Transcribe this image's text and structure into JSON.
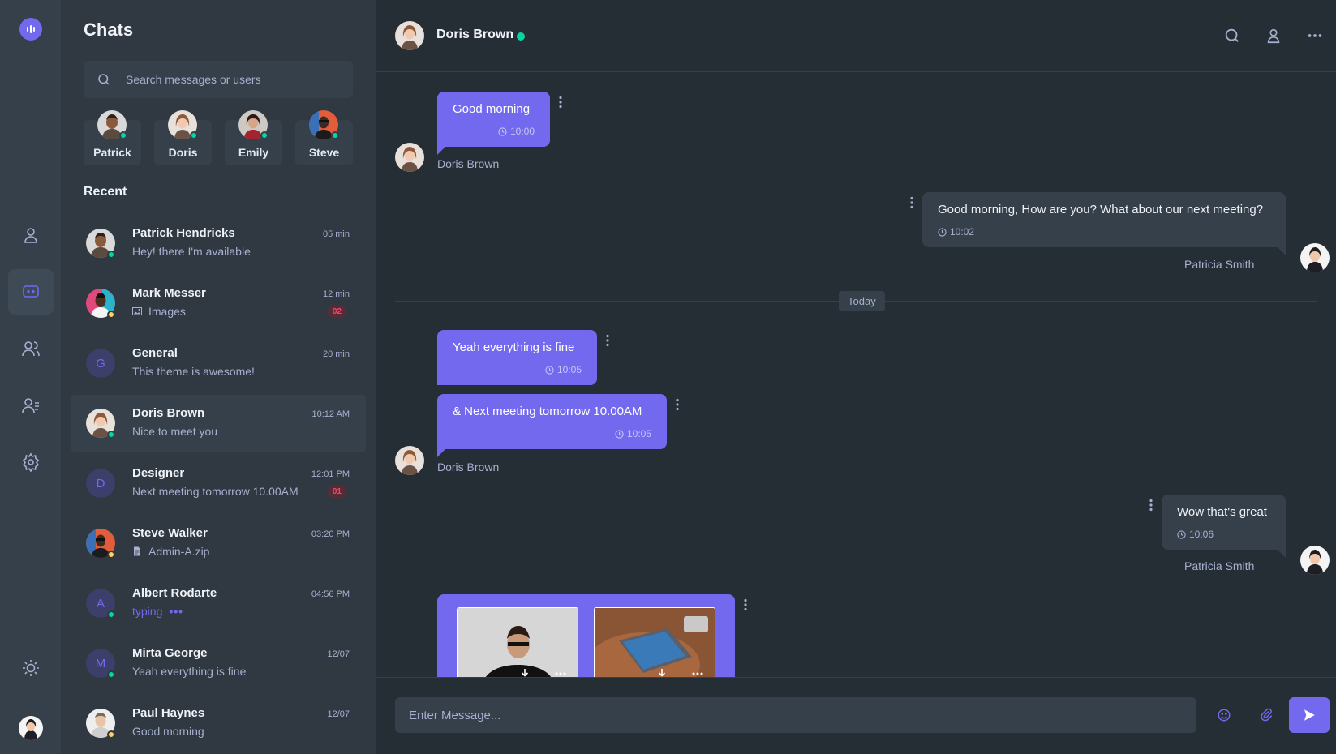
{
  "panel": {
    "title": "Chats",
    "search_placeholder": "Search messages or users",
    "recent_title": "Recent"
  },
  "online_users": [
    {
      "name": "Patrick"
    },
    {
      "name": "Doris"
    },
    {
      "name": "Emily"
    },
    {
      "name": "Steve"
    }
  ],
  "chats": [
    {
      "name": "Patrick Hendricks",
      "message": "Hey! there I'm available",
      "time": "05 min",
      "status": "online"
    },
    {
      "name": "Mark Messer",
      "message": "Images",
      "time": "12 min",
      "badge": "02",
      "status": "away",
      "icon": "image-icon"
    },
    {
      "name": "General",
      "message": "This theme is awesome!",
      "time": "20 min",
      "letter": "G"
    },
    {
      "name": "Doris Brown",
      "message": "Nice to meet you",
      "time": "10:12 AM",
      "status": "online"
    },
    {
      "name": "Designer",
      "message": "Next meeting tomorrow 10.00AM",
      "time": "12:01 PM",
      "badge": "01",
      "letter": "D"
    },
    {
      "name": "Steve Walker",
      "message": "Admin-A.zip",
      "time": "03:20 PM",
      "status": "away",
      "icon": "file-icon"
    },
    {
      "name": "Albert Rodarte",
      "message": "typing",
      "time": "04:56 PM",
      "letter": "A",
      "status": "online"
    },
    {
      "name": "Mirta George",
      "message": "Yeah everything is fine",
      "time": "12/07",
      "letter": "M",
      "status": "online"
    },
    {
      "name": "Paul Haynes",
      "message": "Good morning",
      "time": "12/07",
      "status": "away"
    }
  ],
  "conversation": {
    "contact_name": "Doris Brown",
    "today_label": "Today",
    "messages": [
      {
        "text": "Good morning",
        "time": "10:00",
        "sender": "Doris Brown"
      },
      {
        "text": "Good morning, How are you? What about our next meeting?",
        "time": "10:02",
        "sender": "Patricia Smith"
      },
      {
        "text": "Yeah everything is fine",
        "time": "10:05"
      },
      {
        "text": "& Next meeting tomorrow 10.00AM",
        "time": "10:05",
        "sender": "Doris Brown"
      },
      {
        "text": "Wow that's great",
        "time": "10:06",
        "sender": "Patricia Smith"
      }
    ]
  },
  "composer": {
    "placeholder": "Enter Message..."
  },
  "colors": {
    "accent": "#7269ef",
    "online": "#06d6a0",
    "away": "#ffd166",
    "badge": "#ef476f",
    "background": "#262e35",
    "panel": "#303841",
    "rail": "#36404a"
  }
}
